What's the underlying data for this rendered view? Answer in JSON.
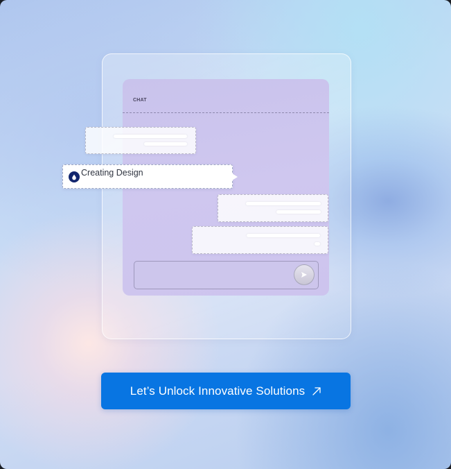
{
  "chat": {
    "title": "CHAT",
    "status": {
      "text": "Creating Design",
      "icon": "drop-icon"
    },
    "input": {
      "placeholder": "",
      "send_icon": "send-icon"
    }
  },
  "cta": {
    "label": "Let’s Unlock Innovative Solutions",
    "icon": "arrow-up-right-icon",
    "color": "#0875e2"
  },
  "colors": {
    "chat_panel": "#cdc6ee",
    "chip_icon": "#12266e"
  }
}
